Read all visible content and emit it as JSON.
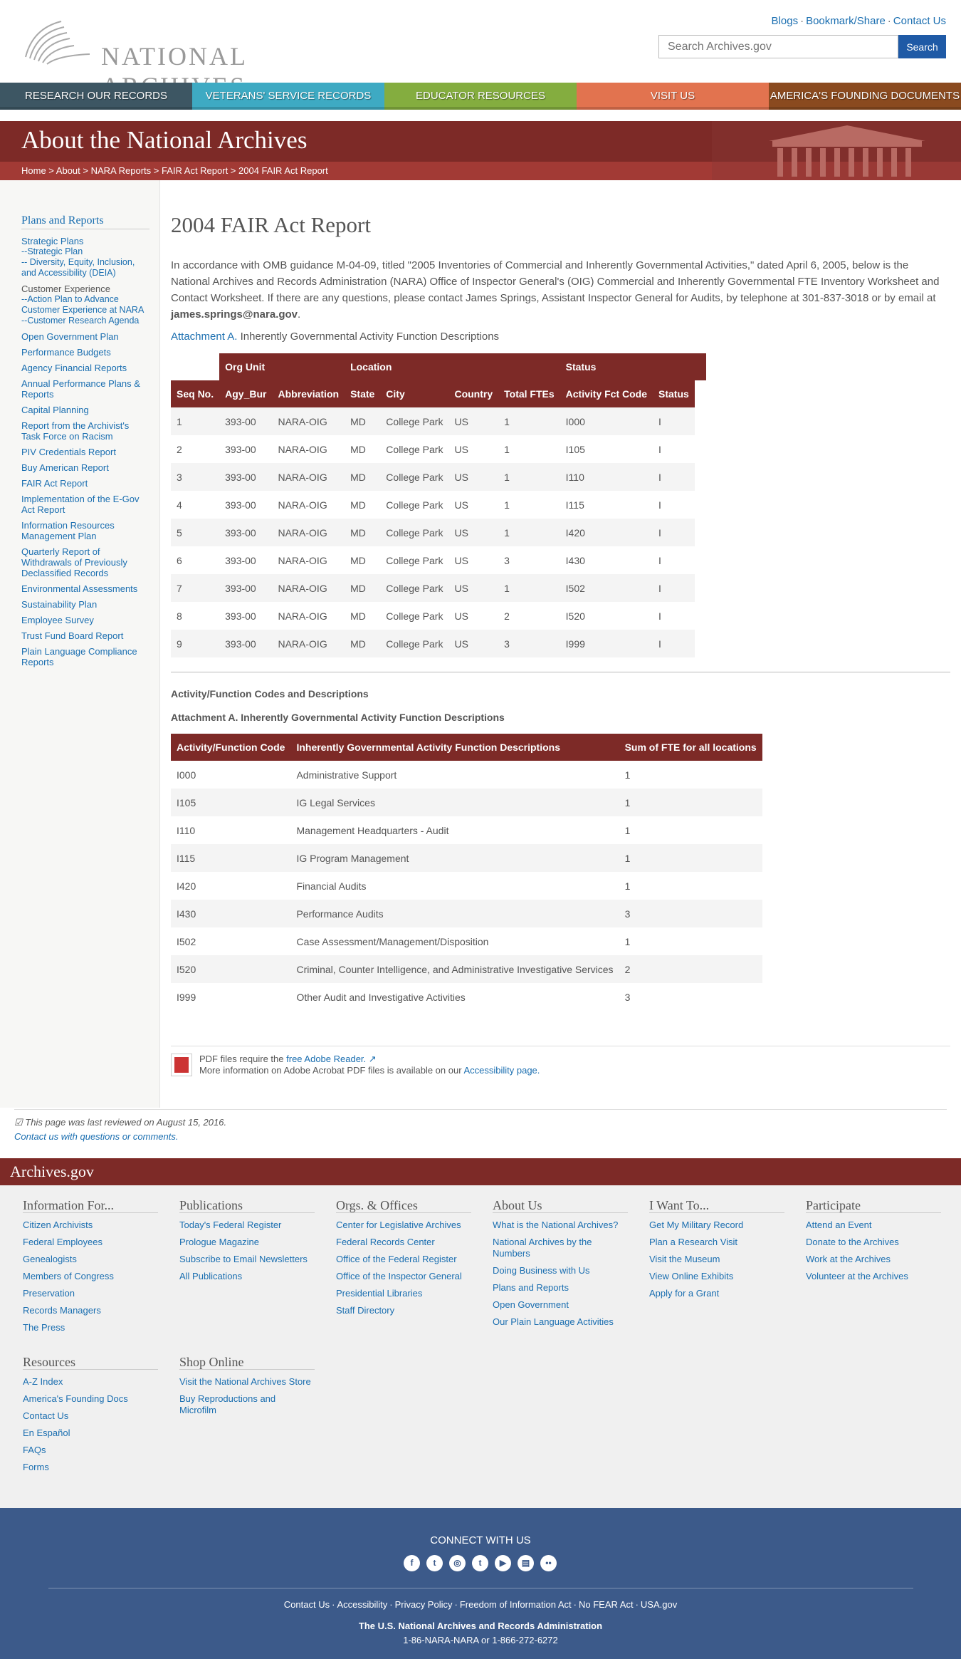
{
  "header": {
    "logo_text": "NATIONAL ARCHIVES",
    "top_links": [
      "Blogs",
      "Bookmark/Share",
      "Contact Us"
    ],
    "search_placeholder": "Search Archives.gov",
    "search_button": "Search"
  },
  "nav": [
    {
      "label": "Research Our Records",
      "color": "#3d5663"
    },
    {
      "label": "Veterans' Service Records",
      "color": "#3eaac3"
    },
    {
      "label": "Educator Resources",
      "color": "#84ad3f"
    },
    {
      "label": "Visit Us",
      "color": "#e2734f"
    },
    {
      "label": "America's Founding Documents",
      "color": "#8a4a1f"
    }
  ],
  "banner": {
    "title": "About the National Archives",
    "breadcrumb": [
      "Home",
      "About",
      "NARA Reports",
      "FAIR Act Report",
      "2004 FAIR Act Report"
    ]
  },
  "sidebar": {
    "heading": "Plans and Reports",
    "items": [
      {
        "label": "Strategic Plans",
        "sub": false,
        "link": true
      },
      {
        "label": "--Strategic Plan",
        "sub": true,
        "link": true
      },
      {
        "label": "-- Diversity, Equity, Inclusion, and Accessibility (DEIA)",
        "sub": true,
        "link": true
      },
      {
        "label": "Customer Experience",
        "sub": false,
        "link": false
      },
      {
        "label": "--Action Plan to Advance Customer Experience at NARA",
        "sub": true,
        "link": true
      },
      {
        "label": "--Customer Research Agenda",
        "sub": true,
        "link": true
      },
      {
        "label": "Open Government Plan",
        "sub": false,
        "link": true
      },
      {
        "label": "Performance Budgets",
        "sub": false,
        "link": true
      },
      {
        "label": "Agency Financial Reports",
        "sub": false,
        "link": true
      },
      {
        "label": "Annual Performance Plans & Reports",
        "sub": false,
        "link": true
      },
      {
        "label": "Capital Planning",
        "sub": false,
        "link": true
      },
      {
        "label": "Report from the Archivist's Task Force on Racism",
        "sub": false,
        "link": true
      },
      {
        "label": "PIV Credentials Report",
        "sub": false,
        "link": true
      },
      {
        "label": "Buy American Report",
        "sub": false,
        "link": true
      },
      {
        "label": "FAIR Act Report",
        "sub": false,
        "link": true
      },
      {
        "label": "Implementation of the E-Gov Act Report",
        "sub": false,
        "link": true
      },
      {
        "label": "Information Resources Management Plan",
        "sub": false,
        "link": true
      },
      {
        "label": "Quarterly Report of Withdrawals of Previously Declassified Records",
        "sub": false,
        "link": true
      },
      {
        "label": "Environmental Assessments",
        "sub": false,
        "link": true
      },
      {
        "label": "Sustainability Plan",
        "sub": false,
        "link": true
      },
      {
        "label": "Employee Survey",
        "sub": false,
        "link": true
      },
      {
        "label": "Trust Fund Board Report",
        "sub": false,
        "link": true
      },
      {
        "label": "Plain Language Compliance Reports",
        "sub": false,
        "link": true
      }
    ]
  },
  "main": {
    "title": "2004 FAIR Act Report",
    "intro": "In accordance with OMB guidance M-04-09, titled \"2005 Inventories of Commercial and Inherently Governmental Activities,\" dated April 6, 2005, below is the National Archives and Records Administration (NARA) Office of Inspector General's (OIG) Commercial and Inherently Governmental FTE Inventory Worksheet and Contact Worksheet. If there are any questions, please contact James Springs, Assistant Inspector General for Audits, by telephone at 301-837-3018 or by email at",
    "email": "james.springs@nara.gov",
    "attachment_link": "Attachment A.",
    "attachment_text": "Inherently Governmental Activity Function Descriptions",
    "table1": {
      "group_headers": [
        "Org Unit",
        "Location",
        "Status"
      ],
      "headers": [
        "Seq No.",
        "Agy_Bur",
        "Abbreviation",
        "State",
        "City",
        "Country",
        "Total FTEs",
        "Activity Fct Code",
        "Status"
      ],
      "rows": [
        [
          "1",
          "393-00",
          "NARA-OIG",
          "MD",
          "College Park",
          "US",
          "1",
          "I000",
          "I"
        ],
        [
          "2",
          "393-00",
          "NARA-OIG",
          "MD",
          "College Park",
          "US",
          "1",
          "I105",
          "I"
        ],
        [
          "3",
          "393-00",
          "NARA-OIG",
          "MD",
          "College Park",
          "US",
          "1",
          "I110",
          "I"
        ],
        [
          "4",
          "393-00",
          "NARA-OIG",
          "MD",
          "College Park",
          "US",
          "1",
          "I115",
          "I"
        ],
        [
          "5",
          "393-00",
          "NARA-OIG",
          "MD",
          "College Park",
          "US",
          "1",
          "I420",
          "I"
        ],
        [
          "6",
          "393-00",
          "NARA-OIG",
          "MD",
          "College Park",
          "US",
          "3",
          "I430",
          "I"
        ],
        [
          "7",
          "393-00",
          "NARA-OIG",
          "MD",
          "College Park",
          "US",
          "1",
          "I502",
          "I"
        ],
        [
          "8",
          "393-00",
          "NARA-OIG",
          "MD",
          "College Park",
          "US",
          "2",
          "I520",
          "I"
        ],
        [
          "9",
          "393-00",
          "NARA-OIG",
          "MD",
          "College Park",
          "US",
          "3",
          "I999",
          "I"
        ]
      ]
    },
    "subheading1": "Activity/Function Codes and Descriptions",
    "subheading2": "Attachment A. Inherently Governmental Activity Function Descriptions",
    "table2": {
      "headers": [
        "Activity/Function Code",
        "Inherently Governmental Activity Function Descriptions",
        "Sum of FTE for all locations"
      ],
      "rows": [
        [
          "I000",
          "Administrative Support",
          "1"
        ],
        [
          "I105",
          "IG Legal Services",
          "1"
        ],
        [
          "I110",
          "Management Headquarters - Audit",
          "1"
        ],
        [
          "I115",
          "IG Program Management",
          "1"
        ],
        [
          "I420",
          "Financial Audits",
          "1"
        ],
        [
          "I430",
          "Performance Audits",
          "3"
        ],
        [
          "I502",
          "Case Assessment/Management/Disposition",
          "1"
        ],
        [
          "I520",
          "Criminal, Counter Intelligence, and Administrative Investigative Services",
          "2"
        ],
        [
          "I999",
          "Other Audit and Investigative Activities",
          "3"
        ]
      ]
    },
    "pdf_note_1": "PDF files require the",
    "pdf_link": "free Adobe Reader.",
    "pdf_note_2": "More information on Adobe Acrobat PDF files is available on our",
    "pdf_link2": "Accessibility page."
  },
  "review": {
    "text": "This page was last reviewed on August 15, 2016.",
    "contact": "Contact us with questions or comments."
  },
  "footer": {
    "brand": "Archives.gov",
    "columns": [
      {
        "title": "Information For...",
        "items": [
          "Citizen Archivists",
          "Federal Employees",
          "Genealogists",
          "Members of Congress",
          "Preservation",
          "Records Managers",
          "The Press"
        ]
      },
      {
        "title": "Publications",
        "items": [
          "Today's Federal Register",
          "Prologue Magazine",
          "Subscribe to Email Newsletters",
          "All Publications"
        ]
      },
      {
        "title": "Orgs. & Offices",
        "items": [
          "Center for Legislative Archives",
          "Federal Records Center",
          "Office of the Federal Register",
          "Office of the Inspector General",
          "Presidential Libraries",
          "Staff Directory"
        ]
      },
      {
        "title": "About Us",
        "items": [
          "What is the National Archives?",
          "National Archives by the Numbers",
          "Doing Business with Us",
          "Plans and Reports",
          "Open Government",
          "Our Plain Language Activities"
        ]
      },
      {
        "title": "I Want To...",
        "items": [
          "Get My Military Record",
          "Plan a Research Visit",
          "Visit the Museum",
          "View Online Exhibits",
          "Apply for a Grant"
        ]
      },
      {
        "title": "Participate",
        "items": [
          "Attend an Event",
          "Donate to the Archives",
          "Work at the Archives",
          "Volunteer at the Archives"
        ]
      },
      {
        "title": "Resources",
        "items": [
          "A-Z Index",
          "America's Founding Docs",
          "Contact Us",
          "En Español",
          "FAQs",
          "Forms"
        ]
      },
      {
        "title": "Shop Online",
        "items": [
          "Visit the National Archives Store",
          "Buy Reproductions and Microfilm"
        ]
      }
    ],
    "connect_title": "CONNECT WITH US",
    "social_icons": [
      "facebook-icon",
      "twitter-icon",
      "instagram-icon",
      "tumblr-icon",
      "youtube-icon",
      "blog-icon",
      "flickr-icon"
    ],
    "bottom_links": [
      "Contact Us",
      "Accessibility",
      "Privacy Policy",
      "Freedom of Information Act",
      "No FEAR Act",
      "USA.gov"
    ],
    "org_name": "The U.S. National Archives and Records Administration",
    "phone": "1-86-NARA-NARA or 1-866-272-6272"
  }
}
